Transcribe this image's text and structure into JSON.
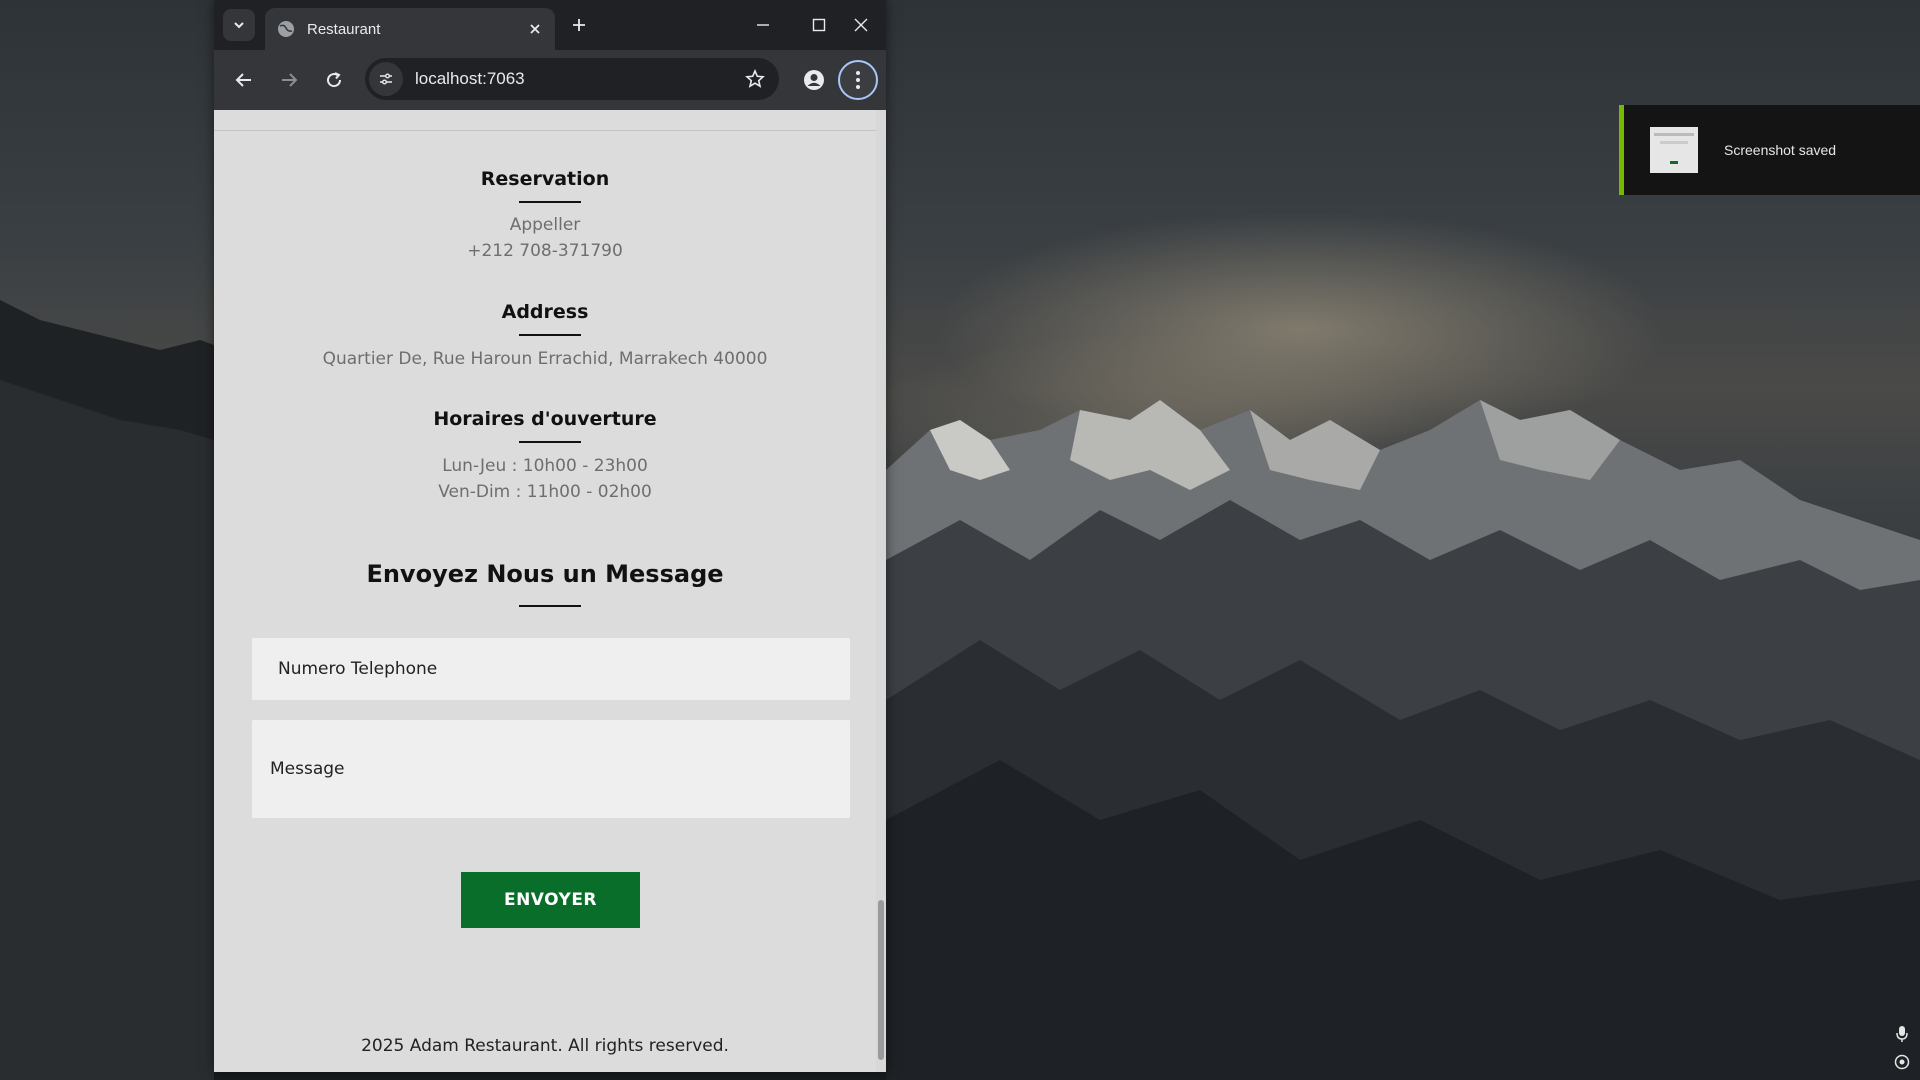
{
  "browser": {
    "tab_title": "Restaurant",
    "url": "localhost:7063"
  },
  "page": {
    "reservation": {
      "title": "Reservation",
      "line1": "Appeller",
      "line2": "+212 708-371790"
    },
    "address": {
      "title": "Address",
      "line1": "Quartier De, Rue Haroun Errachid, Marrakech 40000"
    },
    "hours": {
      "title": "Horaires d'ouverture",
      "line1": "Lun-Jeu : 10h00 - 23h00",
      "line2": "Ven-Dim : 11h00 - 02h00"
    },
    "contact": {
      "title": "Envoyez Nous un Message",
      "phone_placeholder": "Numero Telephone",
      "message_placeholder": "Message",
      "submit_label": "ENVOYER"
    },
    "footer": "2025 Adam Restaurant. All rights reserved."
  },
  "notification": {
    "text": "Screenshot saved",
    "accent_color": "#76b900"
  },
  "colors": {
    "button_green": "#0a6e2b",
    "page_background": "#dcdcdc"
  }
}
